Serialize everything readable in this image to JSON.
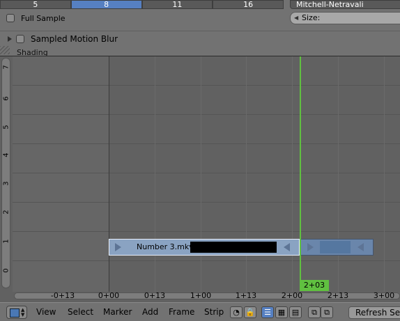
{
  "properties": {
    "samples": [
      "5",
      "8",
      "11",
      "16"
    ],
    "active_sample": "8",
    "filter_value": "Mitchell-Netravali",
    "full_sample_label": "Full Sample",
    "size_label": "Size:",
    "sampled_motion_blur_label": "Sampled Motion Blur",
    "shading_label": "Shading"
  },
  "sequencer": {
    "channels": [
      "0",
      "1",
      "2",
      "3",
      "4",
      "5",
      "6",
      "7"
    ],
    "timeline_ticks": [
      "-0+13",
      "0+00",
      "0+13",
      "1+00",
      "1+13",
      "2+00",
      "2+13",
      "3+00"
    ],
    "current_frame": "2+03",
    "strip": {
      "name": "Number 3.mkv:",
      "color": "#8aa3c2",
      "channel": 1
    },
    "playhead_color": "#60c040"
  },
  "header": {
    "menus": [
      "View",
      "Select",
      "Marker",
      "Add",
      "Frame",
      "Strip"
    ],
    "refresh_label": "Refresh Sequencer"
  }
}
